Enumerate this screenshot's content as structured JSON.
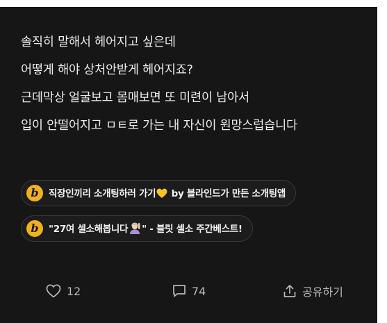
{
  "post": {
    "lines": [
      "솔직히 말해서 헤어지고 싶은데",
      "어떻게 해야 상처안받게 헤어지죠?",
      "근데막상 얼굴보고 몸매보면 또 미련이 남아서",
      "입이 안떨어지고 ㅁㅌ로 가는 내 자신이 원망스럽습니다"
    ]
  },
  "promos": [
    {
      "logo": "b",
      "text_before": "직장인끼리 소개팅하러 가기",
      "text_after": " by 블라인드가 만든 소개팅앱",
      "emoji": "yellow-heart-icon"
    },
    {
      "logo": "b",
      "text_before": "\"27여 셀소해봅니다",
      "text_after": "\" - 블릿 셀소 주간베스트!",
      "emoji": "person-raising-hand-icon"
    }
  ],
  "actions": {
    "like_count": "12",
    "comment_count": "74",
    "share_label": "공유하기"
  },
  "colors": {
    "background": "#161616",
    "text": "#ececec",
    "muted": "#b9b9b9",
    "brand": "#f2b01e",
    "pill_border": "#3a3a3a"
  }
}
